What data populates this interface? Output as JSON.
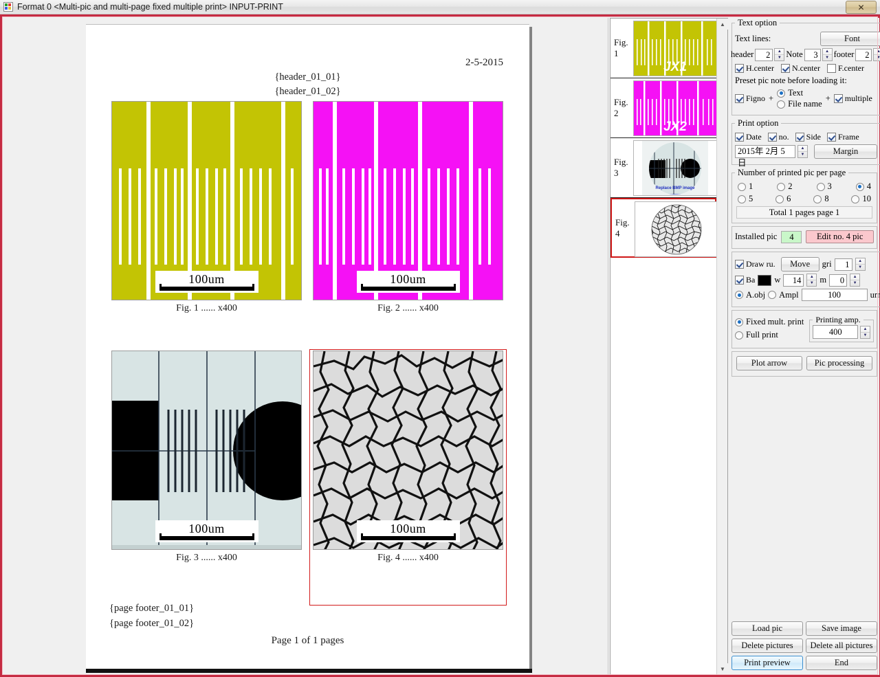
{
  "window": {
    "title": "Format 0 <Multi-pic and multi-page fixed multiple print> INPUT-PRINT",
    "close_label": "✕"
  },
  "document": {
    "date": "2-5-2015",
    "header_line_1": "{header_01_01}",
    "header_line_2": "{header_01_02}",
    "footer_line_1": "{page footer_01_01}",
    "footer_line_2": "{page footer_01_02}",
    "page_number_text": "Page 1 of 1 pages",
    "figures": [
      {
        "caption": "Fig. 1 ...... x400",
        "scalebar": "100um",
        "kind": "stripes-olive",
        "color": "#c3c404",
        "selected": false
      },
      {
        "caption": "Fig. 2 ...... x400",
        "scalebar": "100um",
        "kind": "stripes-magenta",
        "color": "#f511f5",
        "selected": false
      },
      {
        "caption": "Fig. 3 ...... x400",
        "scalebar": "100um",
        "kind": "micrograph-target",
        "color": "#d8e4e4",
        "selected": false
      },
      {
        "caption": "Fig. 4 ...... x400",
        "scalebar": "100um",
        "kind": "grain-structure",
        "color": "#dcdcdc",
        "selected": true
      }
    ]
  },
  "thumbnails": [
    {
      "label": "Fig. 1",
      "overlay_text": "JX1",
      "kind": "stripes-olive",
      "selected": false
    },
    {
      "label": "Fig. 2",
      "overlay_text": "JX2",
      "kind": "stripes-magenta",
      "selected": false
    },
    {
      "label": "Fig. 3",
      "overlay_text": "Replace BMP image",
      "kind": "micrograph-target",
      "selected": false
    },
    {
      "label": "Fig. 4",
      "overlay_text": "",
      "kind": "grain-structure",
      "selected": true
    }
  ],
  "text_option": {
    "group_title": "Text option",
    "text_lines_label": "Text lines:",
    "font_button": "Font",
    "header_label": "header",
    "header_value": "2",
    "note_label": "Note",
    "note_value": "3",
    "footer_label": "footer",
    "footer_value": "2",
    "h_center_label": "H.center",
    "h_center_checked": true,
    "n_center_label": "N.center",
    "n_center_checked": true,
    "f_center_label": "F.center",
    "f_center_checked": false,
    "preset_label": "Preset pic note before loading it:",
    "figno_label": "Figno",
    "figno_checked": true,
    "plus_1": "+",
    "radio_text_label": "Text",
    "radio_filename_label": "File name",
    "radio_selected": "Text",
    "plus_2": "+",
    "multiple_label": "multiple",
    "multiple_checked": true
  },
  "print_option": {
    "group_title": "Print option",
    "date_label": "Date",
    "date_checked": true,
    "no_label": "no.",
    "no_checked": true,
    "side_label": "Side",
    "side_checked": true,
    "frame_label": "Frame",
    "frame_checked": true,
    "date_value": "2015年 2月 5日",
    "margin_button": "Margin"
  },
  "pics_per_page": {
    "group_title": "Number of printed pic per page",
    "options": [
      "1",
      "2",
      "3",
      "4",
      "5",
      "6",
      "8",
      "10"
    ],
    "selected": "4",
    "total_text": "Total 1 pages  page 1"
  },
  "installed": {
    "label": "Installed pic",
    "count": "4",
    "edit_button": "Edit no. 4 pic"
  },
  "ruler": {
    "draw_ruler_label": "Draw ru.",
    "draw_ruler_checked": true,
    "move_button": "Move",
    "grid_label": "gri",
    "grid_value": "1",
    "bar_label": "Ba",
    "bar_checked": true,
    "bar_color": "#000000",
    "w_label": "w",
    "w_value": "14",
    "m_label": "m",
    "m_value": "0",
    "aobj_label": "A.obj",
    "ampl_label": "Ampl",
    "ampl_value": "100",
    "unit_label": "um",
    "mode_selected": "A.obj"
  },
  "print_mode": {
    "fixed_label": "Fixed mult. print",
    "full_label": "Full print",
    "selected": "Fixed mult. print",
    "printing_amp_label": "Printing amp.",
    "printing_amp_value": "400"
  },
  "tools": {
    "plot_arrow": "Plot arrow",
    "pic_processing": "Pic processing"
  },
  "bottom_buttons": {
    "load_pic": "Load pic",
    "save_image": "Save image",
    "delete_pictures": "Delete pictures",
    "delete_all_pictures": "Delete all pictures",
    "print_preview": "Print preview",
    "end": "End"
  },
  "colors": {
    "frame_red": "#c52b42",
    "selection_red": "#cf1717",
    "olive": "#c3c404",
    "magenta": "#f511f5",
    "accent_blue": "#1a6fc4"
  }
}
